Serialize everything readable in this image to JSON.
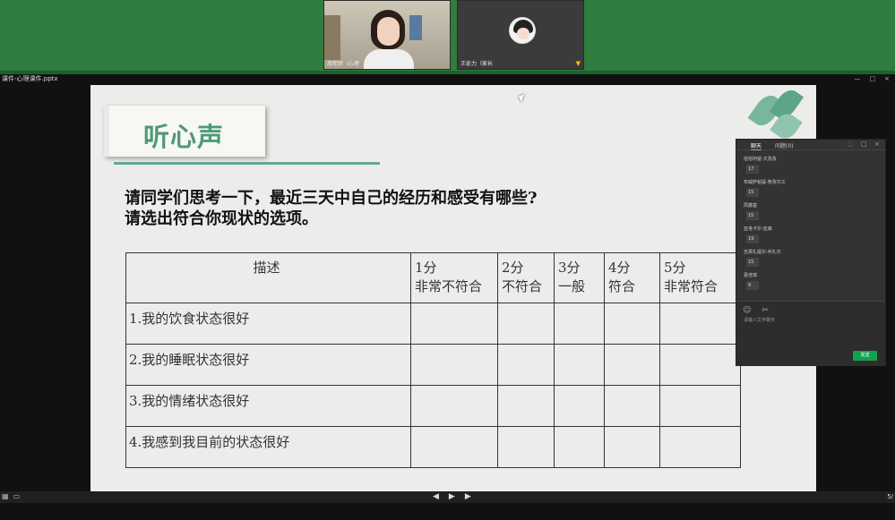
{
  "participants": [
    {
      "name": "周老师（心理",
      "status": "speaking"
    },
    {
      "name": "王俞力（家长",
      "status": "muted"
    }
  ],
  "file": {
    "name": "课件-心理课件.pptx"
  },
  "slide": {
    "title": "听心声",
    "question_line1": "请同学们思考一下，最近三天中自己的经历和感受有哪些?",
    "question_line2": "请选出符合你现状的选项。",
    "table": {
      "headers": [
        "描述",
        "1分\n非常不符合",
        "2分\n不符合",
        "3分\n一般",
        "4分\n符合",
        "5分\n非常符合"
      ],
      "rows": [
        [
          "1.我的饮食状态很好",
          "",
          "",
          "",
          "",
          ""
        ],
        [
          "2.我的睡眠状态很好",
          "",
          "",
          "",
          "",
          ""
        ],
        [
          "3.我的情绪状态很好",
          "",
          "",
          "",
          "",
          ""
        ],
        [
          "4.我感到我目前的状态很好",
          "",
          "",
          "",
          "",
          ""
        ]
      ]
    }
  },
  "chat": {
    "tabs": [
      "聊天",
      "问题(0)"
    ],
    "messages": [
      {
        "sender": "俗俗阿爸-文孜孜",
        "text": "17"
      },
      {
        "sender": "布威萨帕提-祭孜尔江",
        "text": "15"
      },
      {
        "sender": "周鑫楚",
        "text": "15"
      },
      {
        "sender": "亚洛卡尔-亚森",
        "text": "19"
      },
      {
        "sender": "吉那扎提尔-乔扎尔",
        "text": "15"
      },
      {
        "sender": "嘉佳琪",
        "text": "9"
      }
    ],
    "placeholder": "请输入文字聊天",
    "send_label": "发送"
  },
  "controls": {
    "page": "5/"
  },
  "icons": {
    "mic": "mic-icon",
    "emoji": "emoji-icon",
    "scissors": "screenshot-icon"
  }
}
